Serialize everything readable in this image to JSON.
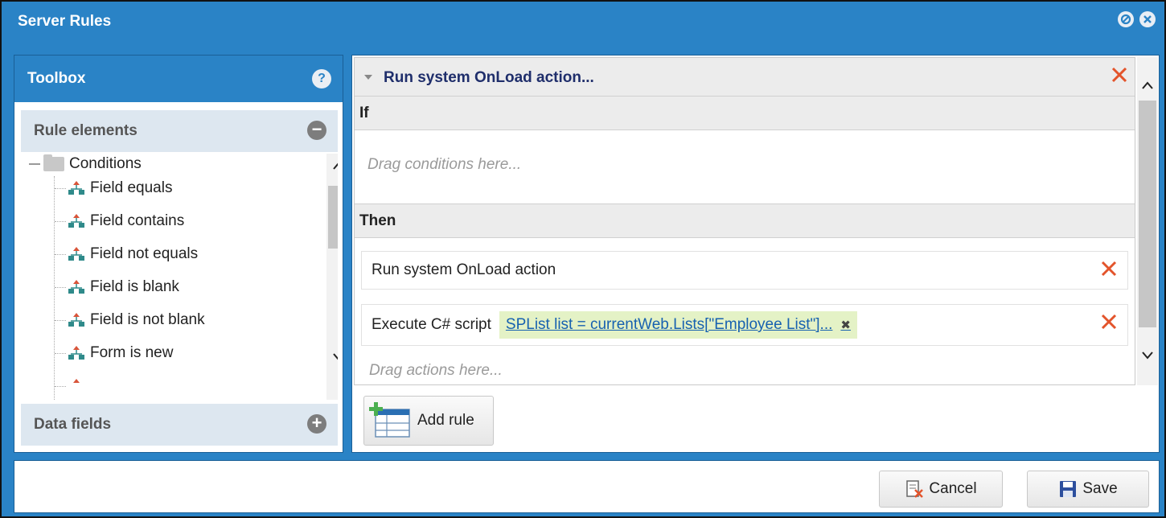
{
  "window": {
    "title": "Server Rules",
    "title_icons": [
      "settings-icon",
      "close-icon"
    ]
  },
  "toolbox": {
    "title": "Toolbox",
    "help_glyph": "?",
    "rule_elements": {
      "label": "Rule elements",
      "toggle_glyph": "−",
      "root": "Conditions",
      "items": [
        "Field equals",
        "Field contains",
        "Field not equals",
        "Field is blank",
        "Field is not blank",
        "Form is new"
      ]
    },
    "data_fields": {
      "label": "Data fields",
      "toggle_glyph": "+"
    }
  },
  "rule": {
    "title": "Run system OnLoad action...",
    "if_label": "If",
    "conditions_placeholder": "Drag conditions here...",
    "then_label": "Then",
    "actions": [
      {
        "label": "Run system OnLoad action"
      },
      {
        "label": "Execute C# script",
        "code": "SPList list = currentWeb.Lists[\"Employee List\"]...",
        "chip_remove": "✖"
      }
    ],
    "actions_placeholder": "Drag actions here..."
  },
  "buttons": {
    "add_rule": "Add rule",
    "cancel": "Cancel",
    "save": "Save"
  },
  "colors": {
    "window_blue": "#2a83c6",
    "delete_red": "#e3542b",
    "code_chip_bg": "#e4f2c6",
    "rule_title": "#1f2e6b"
  }
}
